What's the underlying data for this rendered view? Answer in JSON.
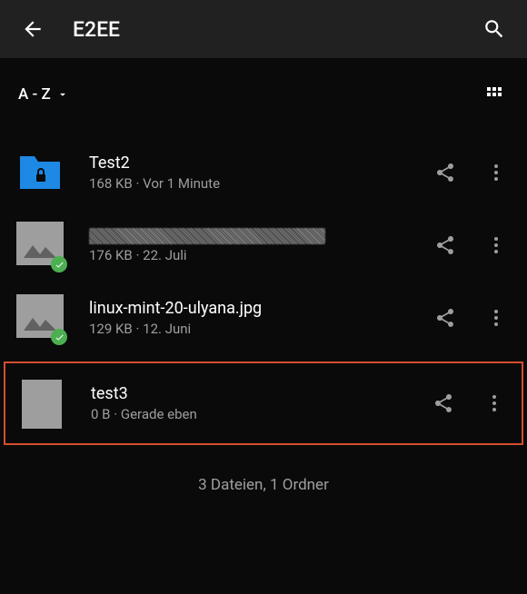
{
  "header": {
    "title": "E2EE"
  },
  "sort": {
    "label": "A - Z"
  },
  "files": [
    {
      "name": "Test2",
      "size": "168 KB",
      "time": "Vor 1 Minute",
      "type": "folder",
      "synced": false,
      "highlighted": false,
      "redacted": false
    },
    {
      "name": "",
      "size": "176 KB",
      "time": "22. Juli",
      "type": "image",
      "synced": true,
      "highlighted": false,
      "redacted": true
    },
    {
      "name": "linux-mint-20-ulyana.jpg",
      "size": "129 KB",
      "time": "12. Juni",
      "type": "image",
      "synced": true,
      "highlighted": false,
      "redacted": false
    },
    {
      "name": "test3",
      "size": "0 B",
      "time": "Gerade eben",
      "type": "document",
      "synced": false,
      "highlighted": true,
      "redacted": false
    }
  ],
  "summary": "3 Dateien, 1 Ordner"
}
